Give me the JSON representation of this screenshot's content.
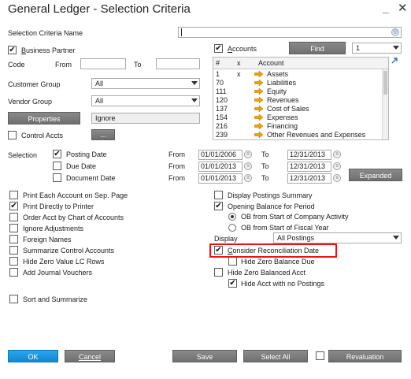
{
  "window": {
    "title": "General Ledger - Selection Criteria",
    "minimize": "_",
    "close": "✕"
  },
  "criteria_name": {
    "label": "Selection Criteria Name",
    "value": ""
  },
  "business_partner": {
    "label": "Business Partner",
    "checked": true
  },
  "code": {
    "label": "Code",
    "from": "From",
    "to": "To",
    "from_value": "",
    "to_value": ""
  },
  "customer_group": {
    "label": "Customer Group",
    "value": "All"
  },
  "vendor_group": {
    "label": "Vendor Group",
    "value": "All"
  },
  "properties": {
    "button": "Properties",
    "value": "Ignore"
  },
  "control_accts": {
    "label": "Control Accts",
    "button": "..."
  },
  "accounts": {
    "label": "Accounts",
    "checked": true,
    "find": "Find",
    "page": "1"
  },
  "accounts_table": {
    "headers": [
      "#",
      "x",
      "Account"
    ],
    "rows": [
      {
        "num": "1",
        "x": "x",
        "account": "Assets"
      },
      {
        "num": "70",
        "x": "",
        "account": "Liabilities"
      },
      {
        "num": "111",
        "x": "",
        "account": "Equity"
      },
      {
        "num": "120",
        "x": "",
        "account": "Revenues"
      },
      {
        "num": "137",
        "x": "",
        "account": "Cost of Sales"
      },
      {
        "num": "154",
        "x": "",
        "account": "Expenses"
      },
      {
        "num": "216",
        "x": "",
        "account": "Financing"
      },
      {
        "num": "239",
        "x": "",
        "account": "Other Revenues and Expenses"
      }
    ]
  },
  "selection": {
    "label": "Selection",
    "from": "From",
    "to": "To",
    "rows": [
      {
        "label": "Posting Date",
        "checked": true,
        "from": "01/01/2006",
        "to": "12/31/2013"
      },
      {
        "label": "Due Date",
        "checked": false,
        "from": "01/01/2013",
        "to": "12/31/2013"
      },
      {
        "label": "Document Date",
        "checked": false,
        "from": "01/01/2013",
        "to": "12/31/2013"
      }
    ],
    "expanded": "Expanded"
  },
  "left_options": [
    {
      "label": "Print Each Account on Sep. Page",
      "checked": false
    },
    {
      "label": "Print Directly to Printer",
      "checked": true
    },
    {
      "label": "Order Acct by Chart of Accounts",
      "checked": false
    },
    {
      "label": "Ignore Adjustments",
      "checked": false
    },
    {
      "label": "Foreign Names",
      "checked": false
    },
    {
      "label": "Summarize Control Accounts",
      "checked": false
    },
    {
      "label": "Hide Zero Value LC Rows",
      "checked": false
    },
    {
      "label": "Add Journal Vouchers",
      "checked": false
    }
  ],
  "right_options": {
    "display_postings_summary": {
      "label": "Display Postings Summary",
      "checked": false
    },
    "opening_balance": {
      "label": "Opening Balance for Period",
      "checked": true
    },
    "ob_company": {
      "label": "OB from Start of Company Activity",
      "selected": true
    },
    "ob_fiscal": {
      "label": "OB from Start of Fiscal Year",
      "selected": false
    },
    "display": {
      "label": "Display",
      "value": "All Postings"
    },
    "consider_reconciliation": {
      "label": "Consider Reconciliation Date",
      "checked": true
    },
    "hide_zero_balance_due": {
      "label": "Hide Zero Balance Due",
      "checked": false
    },
    "hide_zero_balanced_acct": {
      "label": "Hide Zero Balanced Acct",
      "checked": false
    },
    "hide_acct_no_postings": {
      "label": "Hide Acct with no Postings",
      "checked": true
    }
  },
  "sort_and_summarize": {
    "label": "Sort and Summarize",
    "checked": false
  },
  "footer": {
    "ok": "OK",
    "cancel": "Cancel",
    "save": "Save",
    "select_all": "Select All",
    "revaluation": "Revaluation"
  },
  "colors": {
    "ok_blue": "#1a93dd",
    "button_gray": "#7a7a7a",
    "highlight_red": "#e11111",
    "arrow_orange": "#f0a000"
  }
}
